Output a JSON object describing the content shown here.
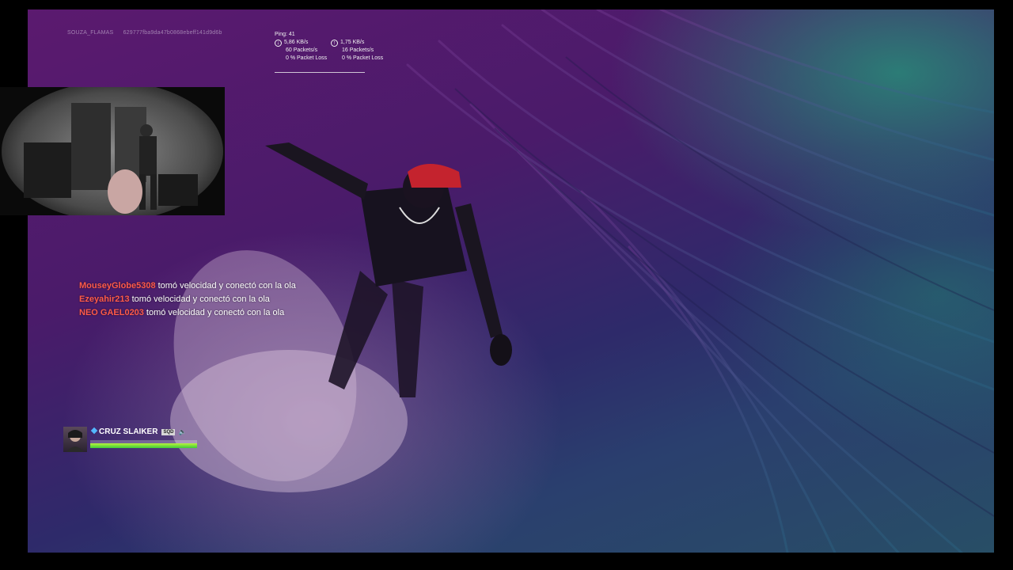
{
  "stream_overlay": {
    "username": "SOUZA_FLAMAS",
    "session_id": "629777fba9da47b0868ebeff141d9d6b"
  },
  "net_stats": {
    "ping": "Ping: 41",
    "download": {
      "rate": "5,86 KB/s",
      "packets": "60 Packets/s",
      "loss": "0 % Packet Loss"
    },
    "upload": {
      "rate": "1,75 KB/s",
      "packets": "16 Packets/s",
      "loss": "0 % Packet Loss"
    }
  },
  "feed": [
    {
      "player": "MouseyGlobe5308",
      "message": "tomó velocidad y conectó con la ola"
    },
    {
      "player": "Ezeyahir213",
      "message": "tomó velocidad y conectó con la ola"
    },
    {
      "player": "NEO GAEL0203",
      "message": "tomó velocidad y conectó con la ola"
    }
  ],
  "player_card": {
    "name": "CRUZ SLAIKER",
    "badge": "SQD",
    "shield_fraction": 1.0,
    "health_fraction": 1.0
  },
  "icons": {
    "download": "download-arrow-icon",
    "upload": "upload-arrow-icon",
    "speaker": "speaker-icon",
    "diamond": "platform-diamond-icon"
  },
  "colors": {
    "feed_name": "#ff5a4a",
    "shield": "#7ee63a",
    "diamond": "#53b7ff"
  }
}
